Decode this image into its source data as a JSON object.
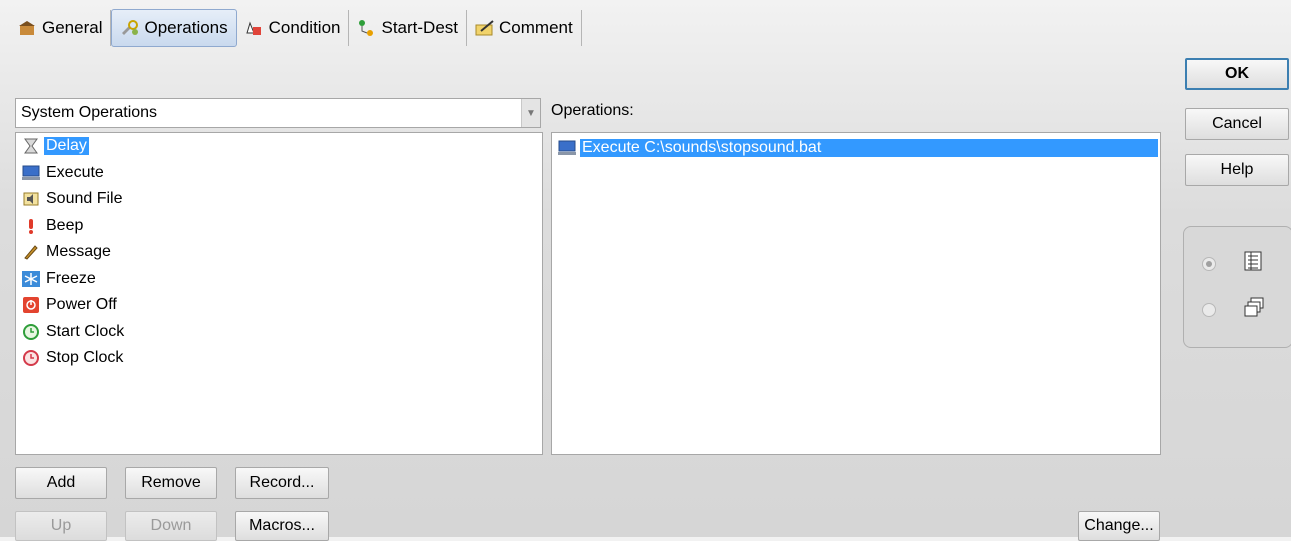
{
  "tabs": [
    {
      "label": "General",
      "icon": "general-icon"
    },
    {
      "label": "Operations",
      "icon": "operations-icon",
      "active": true
    },
    {
      "label": "Condition",
      "icon": "condition-icon"
    },
    {
      "label": "Start-Dest",
      "icon": "start-dest-icon"
    },
    {
      "label": "Comment",
      "icon": "comment-icon"
    }
  ],
  "category": {
    "selected": "System Operations"
  },
  "available_ops": [
    {
      "label": "Delay",
      "icon": "hourglass-icon",
      "selected": true
    },
    {
      "label": "Execute",
      "icon": "computer-icon"
    },
    {
      "label": "Sound File",
      "icon": "speaker-icon"
    },
    {
      "label": "Beep",
      "icon": "exclamation-icon"
    },
    {
      "label": "Message",
      "icon": "pencil-icon"
    },
    {
      "label": "Freeze",
      "icon": "snowflake-icon"
    },
    {
      "label": "Power Off",
      "icon": "power-icon"
    },
    {
      "label": "Start Clock",
      "icon": "green-clock-icon"
    },
    {
      "label": "Stop Clock",
      "icon": "red-clock-icon"
    }
  ],
  "operations_label": "Operations:",
  "operations": [
    {
      "label": "Execute C:\\sounds\\stopsound.bat",
      "icon": "computer-icon",
      "selected": true
    }
  ],
  "buttons": {
    "add": "Add",
    "remove": "Remove",
    "record": "Record...",
    "up": "Up",
    "down": "Down",
    "macros": "Macros...",
    "change": "Change...",
    "ok": "OK",
    "cancel": "Cancel",
    "help": "Help"
  },
  "colors": {
    "selection": "#3399ff",
    "ok_border": "#3c7fb1"
  }
}
